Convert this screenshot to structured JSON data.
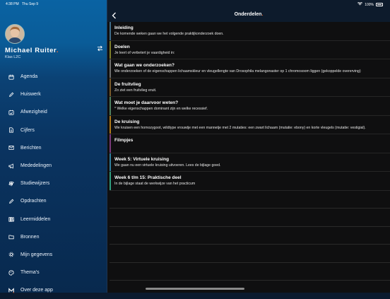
{
  "status_bar": {
    "time": "4:38 PM",
    "date": "Thu Sep 9",
    "battery": "100%"
  },
  "profile": {
    "name": "Michael  Ruiter",
    "name_dot": ".",
    "class": "Klas L2C"
  },
  "menu": [
    {
      "label": "Agenda",
      "icon": "calendar-icon"
    },
    {
      "label": "Huiswerk",
      "icon": "pencil-icon"
    },
    {
      "label": "Afwezigheid",
      "icon": "calendar-check-icon"
    },
    {
      "label": "Cijfers",
      "icon": "document-icon"
    },
    {
      "label": "Berichten",
      "icon": "envelope-icon"
    },
    {
      "label": "Mededelingen",
      "icon": "megaphone-icon"
    },
    {
      "label": "Studiewijzers",
      "icon": "signpost-icon"
    },
    {
      "label": "Opdrachten",
      "icon": "pencil-icon"
    },
    {
      "label": "Leermiddelen",
      "icon": "books-icon"
    },
    {
      "label": "Bronnen",
      "icon": "folder-icon"
    },
    {
      "label": "Mijn gegevens",
      "icon": "gear-icon"
    },
    {
      "label": "Thema's",
      "icon": "palette-icon"
    },
    {
      "label": "Over deze app",
      "icon": "logo-m-icon"
    }
  ],
  "header": {
    "title": "Onderdelen",
    "title_dot": "."
  },
  "items": [
    {
      "title": "Inleiding",
      "text": "De komende weken gaan we het volgende praktijkonderzoek doen.",
      "accent": "#3f6d8a"
    },
    {
      "title": "Doelen",
      "text": "Je leert of verbetert je vaardigheid in:",
      "accent": "#7f7f2a"
    },
    {
      "title": "Wat gaan we onderzoeken?",
      "text": "We onderzoeken of de eigenschappen lichaamskleur en vleugellengte van Drosophila melangonaster op 1 chromosoom liggen (gekoppelde overerving)",
      "accent": "#6e6e6e"
    },
    {
      "title": "De fruitvlieg",
      "text": "Zo ziet een fruitvlieg eruit.",
      "accent": "#7a5a2a"
    },
    {
      "title": "Wat moet je daarvoor weten?",
      "text": "* Welke eigenschappen dominant zijn en welke recessief.",
      "accent": "#4f7f5f"
    },
    {
      "title": "De kruising",
      "text": "We kruisen een homozygoot, wildtype vrouwtje met een mannetje met 2 mutaties: een zwart lichaam (mutatie: ebony) en korte vleugels (mutatie: vestigial).",
      "accent": "#b07a1a"
    },
    {
      "title": "Filmpjes",
      "text": "",
      "accent": "#7a3a7a"
    },
    {
      "title": "Week 5: Virtuele kruising",
      "text": "We gaan nu een virtuele kruising uitvoeren. Lees de bijlage goed.",
      "accent": "#2f7f9f"
    },
    {
      "title": "Week 6 t/m 15: Praktische deel",
      "text": "In de bijlage staat de werkwijze van het practicum",
      "accent": "#2f9f7f"
    }
  ]
}
